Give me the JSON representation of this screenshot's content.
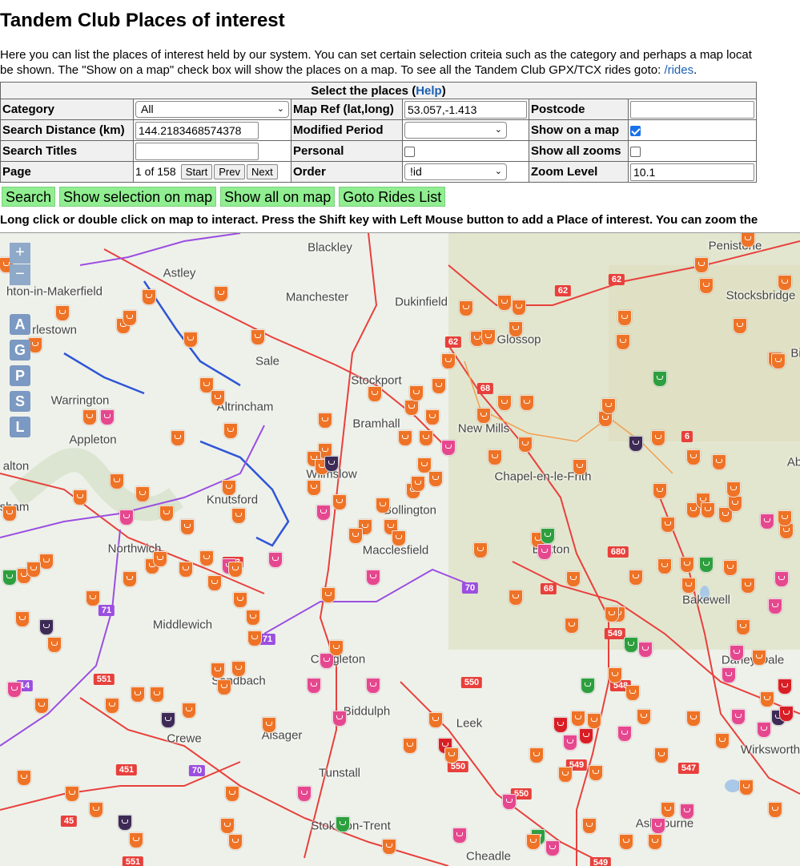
{
  "page": {
    "title": "Tandem Club Places of interest",
    "intro_line1": "Here you can list the places of interest held by our system. You can set certain selection criteia such as the category and perhaps a map locat",
    "intro_line2": "be shown. The \"Show on a map\" check box will show the places on a map. To see all the Tandem Club GPX/TCX rides goto: ",
    "rides_link": "/rides",
    "intro_end": "."
  },
  "form": {
    "header": "Select the places (",
    "help_link": "Help",
    "header_end": ")",
    "category_label": "Category",
    "category_value": "All",
    "mapref_label": "Map Ref (lat,long)",
    "mapref_value": "53.057,-1.413",
    "postcode_label": "Postcode",
    "postcode_value": "",
    "distance_label": "Search Distance (km)",
    "distance_value": "144.2183468574378",
    "modified_label": "Modified Period",
    "modified_value": "",
    "show_map_label": "Show on a map",
    "show_map_checked": true,
    "titles_label": "Search Titles",
    "titles_value": "",
    "personal_label": "Personal",
    "personal_checked": false,
    "show_zooms_label": "Show all zooms",
    "show_zooms_checked": false,
    "page_label": "Page",
    "page_value": "1 of 158",
    "start_label": "Start",
    "prev_label": "Prev",
    "next_label": "Next",
    "order_label": "Order",
    "order_value": "!id",
    "zoom_label": "Zoom Level",
    "zoom_value": "10.1"
  },
  "actions": {
    "search": "Search",
    "show_selection": "Show selection on map",
    "show_all": "Show all on map",
    "goto_rides": "Goto Rides List"
  },
  "note": "Long click or double click on map to interact. Press the Shift key with Left Mouse button to add a Place of interest. You can zoom the",
  "map": {
    "zoom_in": "+",
    "zoom_out": "−",
    "controls": [
      "A",
      "G",
      "P",
      "S",
      "L"
    ],
    "towns": [
      "Blackley",
      "Astley",
      "Penistone",
      "Manchester",
      "Dukinfield",
      "hton-in-Makerfield",
      "Stocksbridge",
      "rlestown",
      "Glossop",
      "Sale",
      "Stockport",
      "Warrington",
      "Altrincham",
      "Bramhall",
      "New Mills",
      "Appleton",
      "Chapel-en-le-Frith",
      "alton",
      "Wilmslow",
      "sham",
      "Knutsford",
      "Bollington",
      "Northwich",
      "Macclesfield",
      "Buxton",
      "Bakewell",
      "Middlewich",
      "Congleton",
      "Darley Dale",
      "Sandbach",
      "Biddulph",
      "Crewe",
      "Alsager",
      "Leek",
      "Wirksworth",
      "Tunstall",
      "Ashbourne",
      "Stoke-on-Trent",
      "Cheadle",
      "Ab",
      "Bi"
    ],
    "roads": [
      "62",
      "62",
      "62",
      "68",
      "6",
      "573",
      "680",
      "70",
      "68",
      "71",
      "71",
      "549",
      "548",
      "551",
      "14",
      "550",
      "70",
      "451",
      "550",
      "549",
      "547",
      "45",
      "550",
      "551",
      "549"
    ]
  }
}
